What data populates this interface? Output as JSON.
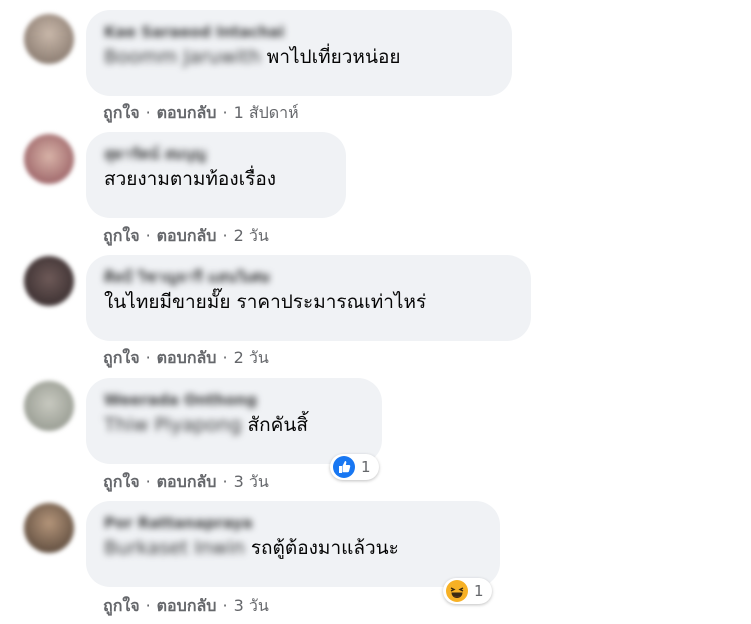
{
  "comments": [
    {
      "author": "Kae Saraeod Intachai",
      "tagged": "Boomm Jaruwith",
      "text": "พาไปเที่ยวหน่อย",
      "like": "ถูกใจ",
      "reply": "ตอบกลับ",
      "time": "1 สัปดาห์"
    },
    {
      "author": "สุดารัตน์ สมบุญ",
      "text": "สวยงามตามท้องเรื่อง",
      "like": "ถูกใจ",
      "reply": "ตอบกลับ",
      "time": "2 วัน"
    },
    {
      "author": "ศิลป์ วิชาญจารี แสนวิเศษ",
      "text": "ในไทยมีขายมั๊ย ราคาประมารณเท่าไหร่",
      "like": "ถูกใจ",
      "reply": "ตอบกลับ",
      "time": "2 วัน"
    },
    {
      "author": "Weerada Onthong",
      "tagged": "Thiw Piyapong",
      "text": "สักคันสิ้",
      "like": "ถูกใจ",
      "reply": "ตอบกลับ",
      "time": "3 วัน",
      "reaction_count": "1",
      "reaction_icon": "like-icon"
    },
    {
      "author": "Por Rattanapraya",
      "tagged": "Burkaset Inwin",
      "text": "รถตู้ต้องมาแล้วนะ",
      "like": "ถูกใจ",
      "reply": "ตอบกลับ",
      "time": "3 วัน",
      "reaction_count": "1",
      "reaction_icon": "haha-icon"
    }
  ],
  "colors": {
    "bubble": "#f0f2f5",
    "meta": "#65676b",
    "like_blue": "#1877f2",
    "haha_yellow": "#f7b125"
  }
}
